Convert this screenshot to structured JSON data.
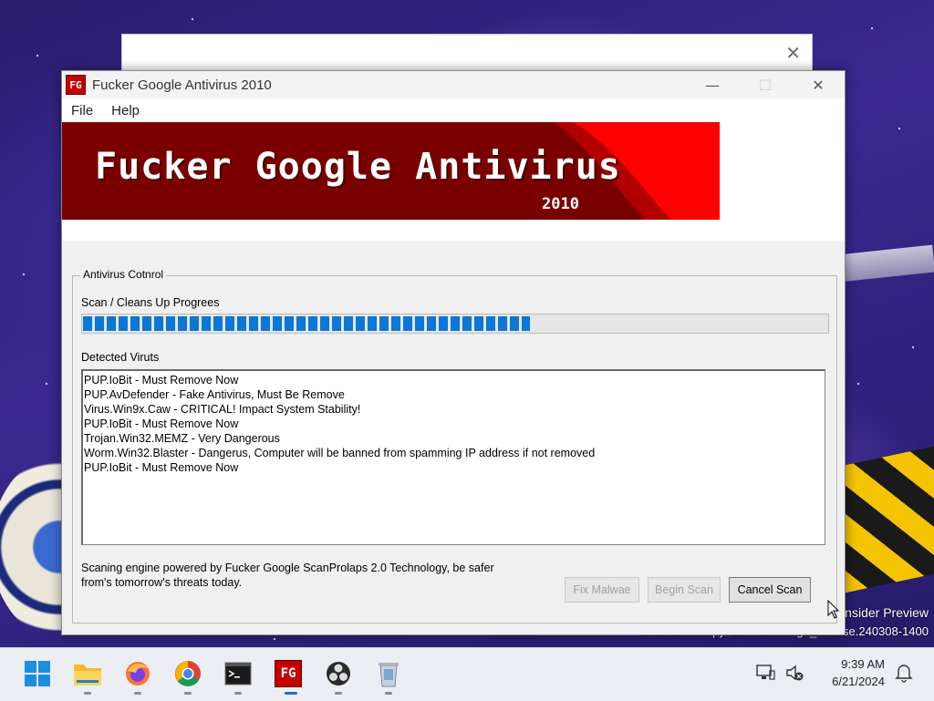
{
  "desktop": {
    "watermark_line1": "nsider Preview",
    "watermark_line2": "Evaluation copy. Build 26000.ge_release.240308-1400"
  },
  "background_dialog": {
    "close_glyph": "✕"
  },
  "window": {
    "title": "Fucker Google Antivirus 2010",
    "icon_text": "FG",
    "controls": {
      "minimize": "—",
      "maximize": "☐",
      "close": "✕"
    },
    "menu": [
      "File",
      "Help"
    ],
    "banner": {
      "title": "Fucker Google Antivirus",
      "year": "2010"
    },
    "group": {
      "legend": "Antivirus Cotnrol",
      "progress_label": "Scan / Cleans Up Progrees",
      "progress_percent": 60,
      "detected_label": "Detected Viruts",
      "detected": [
        "PUP.IoBit - Must Remove Now",
        "PUP.AvDefender - Fake Antivirus, Must Be Remove",
        "Virus.Win9x.Caw - CRITICAL! Impact System Stability!",
        "PUP.IoBit - Must Remove Now",
        "Trojan.Win32.MEMZ - Very Dangerous",
        "Worm.Win32.Blaster - Dangerus, Computer will be banned from spamming IP address if not removed",
        "PUP.IoBit - Must Remove Now"
      ],
      "footer": "Scaning engine powered by Fucker Google ScanProlaps 2.0 Technology, be safer from's tomorrow's threats today.",
      "buttons": {
        "fix": "Fix Malwae",
        "begin": "Begin Scan",
        "cancel": "Cancel Scan"
      }
    }
  },
  "taskbar": {
    "apps": [
      "windows-start-icon",
      "file-explorer-icon",
      "firefox-icon",
      "chrome-icon",
      "terminal-icon",
      "fg-antivirus-icon",
      "obs-icon",
      "recycle-bin-icon"
    ],
    "fg_icon_text": "FG",
    "time": "9:39 AM",
    "date": "6/21/2024"
  },
  "colors": {
    "banner_dark": "#7a0000",
    "banner_red": "#ff0000",
    "progress_blue": "#0a78d7"
  }
}
